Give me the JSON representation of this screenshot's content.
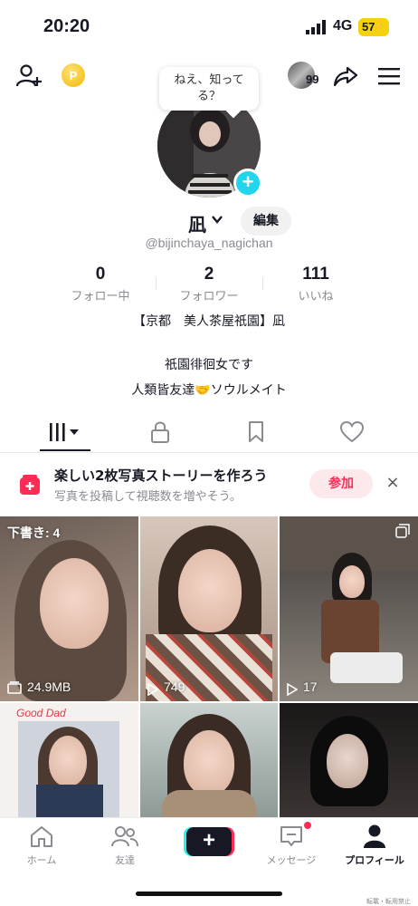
{
  "status_bar": {
    "time": "20:20",
    "network": "4G",
    "battery": "57"
  },
  "top_bar": {
    "coin_symbol": "P",
    "friend_badge": "99"
  },
  "bubble": {
    "text_line1": "ねえ、知って",
    "text_line2": "る？"
  },
  "profile": {
    "name": "凪",
    "edit_label": "編集",
    "handle": "@bijinchaya_nagichan",
    "stats": [
      {
        "value": "0",
        "label": "フォロー中"
      },
      {
        "value": "2",
        "label": "フォロワー"
      },
      {
        "value": "111",
        "label": "いいね"
      }
    ],
    "bio_line1": "【京都　美人茶屋祇園】凪",
    "bio_line2": "祇園徘徊女です",
    "bio_line3": "人類皆友達🤝ソウルメイト"
  },
  "promo": {
    "title": "楽しい2枚写真ストーリーを作ろう",
    "subtitle": "写真を投稿して視聴数を増やそう。",
    "join_label": "参加",
    "close_label": "×"
  },
  "grid": {
    "drafts_label": "下書き: 4",
    "items": [
      {
        "stat": "24.9MB"
      },
      {
        "stat": "749"
      },
      {
        "stat": "17"
      },
      {
        "overlay": "Good Dad"
      }
    ]
  },
  "nav": {
    "home": "ホーム",
    "friends": "友達",
    "messages": "メッセージ",
    "profile": "プロフィール"
  },
  "watermark": "転載・転用禁止",
  "colors": {
    "accent": "#fe2c55",
    "cyan": "#20d5ec",
    "battery": "#f5d20d"
  }
}
